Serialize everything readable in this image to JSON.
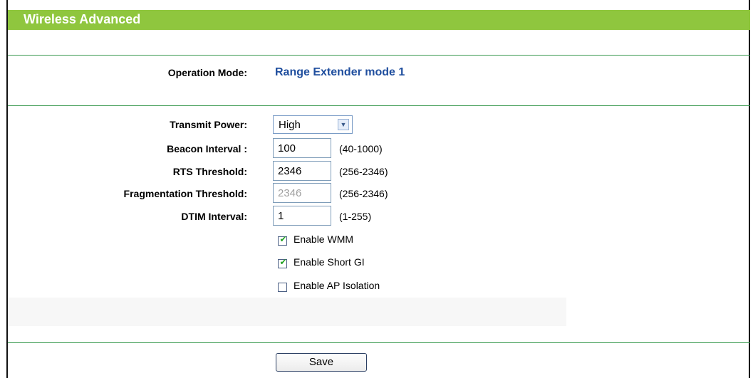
{
  "header": {
    "title": "Wireless Advanced"
  },
  "operation_mode": {
    "label": "Operation Mode:",
    "value": "Range Extender mode 1"
  },
  "transmit_power": {
    "label": "Transmit Power:",
    "selected": "High",
    "icon": "chevron-down-icon"
  },
  "beacon_interval": {
    "label": "Beacon Interval :",
    "value": "100",
    "range": "(40-1000)"
  },
  "rts_threshold": {
    "label": "RTS Threshold:",
    "value": "2346",
    "range": "(256-2346)"
  },
  "fragmentation_threshold": {
    "label": "Fragmentation Threshold:",
    "value": "2346",
    "range": "(256-2346)",
    "disabled": true
  },
  "dtim_interval": {
    "label": "DTIM Interval:",
    "value": "1",
    "range": "(1-255)"
  },
  "checkboxes": {
    "wmm": {
      "label": "Enable WMM",
      "checked": true
    },
    "short_gi": {
      "label": "Enable Short GI",
      "checked": true
    },
    "ap_isolation": {
      "label": "Enable AP Isolation",
      "checked": false
    }
  },
  "save_button": {
    "label": "Save"
  },
  "colors": {
    "header_bg": "#8fc63e",
    "line": "#3a9a50",
    "mode_value": "#1f4e9e",
    "check": "#21a121"
  }
}
